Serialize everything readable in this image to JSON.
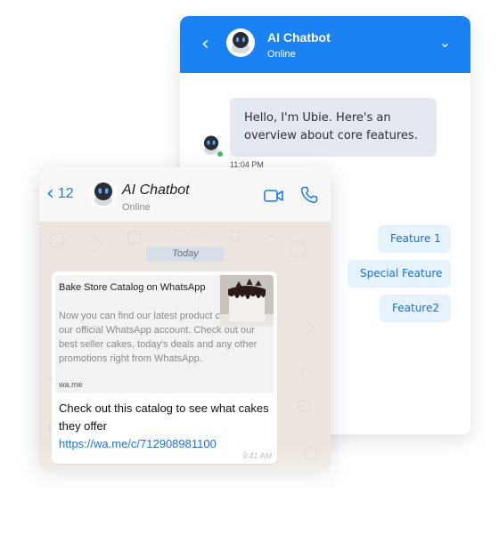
{
  "web_chat": {
    "title": "AI Chatbot",
    "status": "Online",
    "back_icon": "chevron-left-icon",
    "collapse_icon": "chevron-down-icon",
    "message": "Hello, I'm Ubie. Here's an overview about core features.",
    "message_time": "11:04 PM",
    "quick_replies": [
      "Feature 1",
      "Special Feature",
      "Feature2"
    ],
    "colors": {
      "header": "#1a82f5",
      "bubble": "#e4e9f1",
      "quick_reply_bg": "#e6f2fd",
      "quick_reply_text": "#1a6fd8",
      "online": "#35c45a"
    }
  },
  "whatsapp": {
    "back_count": "12",
    "title": "AI Chatbot",
    "status": "Online",
    "icons": [
      "chevron-left-icon",
      "video-call-icon",
      "phone-icon",
      "robot-avatar-icon"
    ],
    "date_divider": "Today",
    "link_preview": {
      "title": "Bake Store Catalog on WhatsApp",
      "description": "Now you can find our latest product catalog on our official WhatsApp account. Check out our best seller cakes, today's deals and any other promotions right from WhatsApp.",
      "domain": "wa.me"
    },
    "message_text": "Check out this catalog to see what cakes they offer",
    "message_link": "https://wa.me/c/712908981100",
    "message_time": "9:41 AM",
    "colors": {
      "accent": "#1b7cf2",
      "background": "#ece5dd",
      "link": "#1a73d9"
    }
  }
}
